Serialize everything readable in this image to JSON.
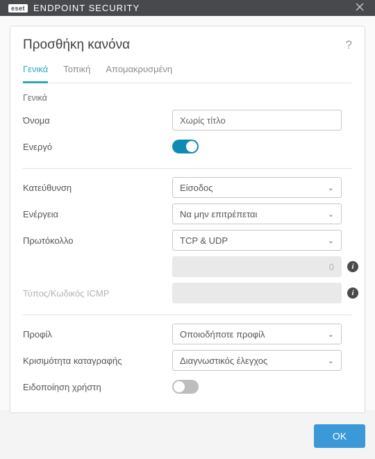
{
  "titlebar": {
    "brand_badge": "eset",
    "brand_text": "ENDPOINT SECURITY"
  },
  "heading": "Προσθήκη κανόνα",
  "tabs": {
    "general": "Γενικά",
    "local": "Τοπική",
    "remote": "Απομακρυσμένη"
  },
  "sections": {
    "general_header": "Γενικά",
    "name_label": "Όνομα",
    "name_value": "Χωρίς τίτλο",
    "enabled_label": "Ενεργό",
    "enabled_value": true,
    "direction_label": "Κατεύθυνση",
    "direction_value": "Είσοδος",
    "action_label": "Ενέργεια",
    "action_value": "Να μην επιτρέπεται",
    "protocol_label": "Πρωτόκολλο",
    "protocol_value": "TCP & UDP",
    "protocol_number": "0",
    "icmp_label": "Τύπος/Κωδικός ICMP",
    "profile_label": "Προφίλ",
    "profile_value": "Οποιοδήποτε προφίλ",
    "severity_label": "Κρισιμότητα καταγραφής",
    "severity_value": "Διαγνωστικός έλεγχος",
    "notify_label": "Ειδοποίηση χρήστη",
    "notify_value": false
  },
  "footer": {
    "ok": "OK"
  }
}
